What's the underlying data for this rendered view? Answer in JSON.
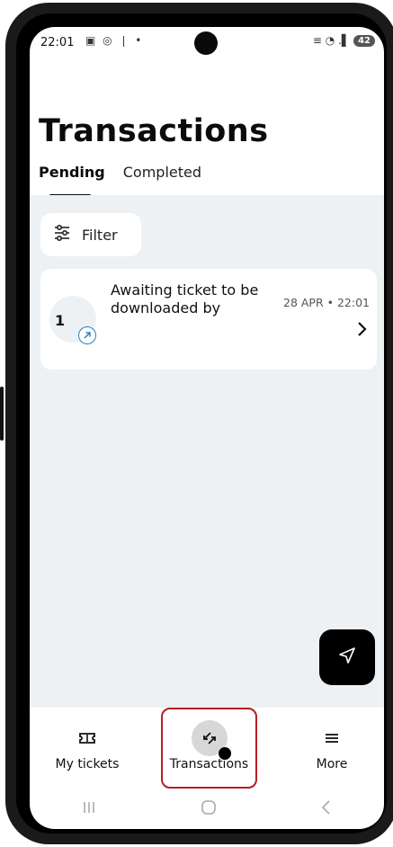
{
  "status_bar": {
    "time": "22:01",
    "left_icons": "▣ ◎ ❘ •",
    "right_icons": "≡ ◔ .▌",
    "battery": "42"
  },
  "page": {
    "title": "Transactions"
  },
  "tabs": [
    {
      "label": "Pending",
      "active": true
    },
    {
      "label": "Completed",
      "active": false
    }
  ],
  "filter": {
    "label": "Filter",
    "icon": "sliders-icon"
  },
  "transactions": [
    {
      "count": "1",
      "description": "Awaiting ticket to be downloaded by",
      "date": "28 APR • 22:01",
      "icon": "transfer-out-icon"
    }
  ],
  "fab": {
    "icon": "send-icon"
  },
  "bottom_nav": [
    {
      "label": "My tickets",
      "icon": "ticket-icon",
      "active": false
    },
    {
      "label": "Transactions",
      "icon": "transfer-icon",
      "active": true
    },
    {
      "label": "More",
      "icon": "menu-icon",
      "active": false
    }
  ],
  "colors": {
    "accent_outline": "#b51e24",
    "badge_blue": "#2a7fb8",
    "content_bg": "#eef1f4"
  }
}
